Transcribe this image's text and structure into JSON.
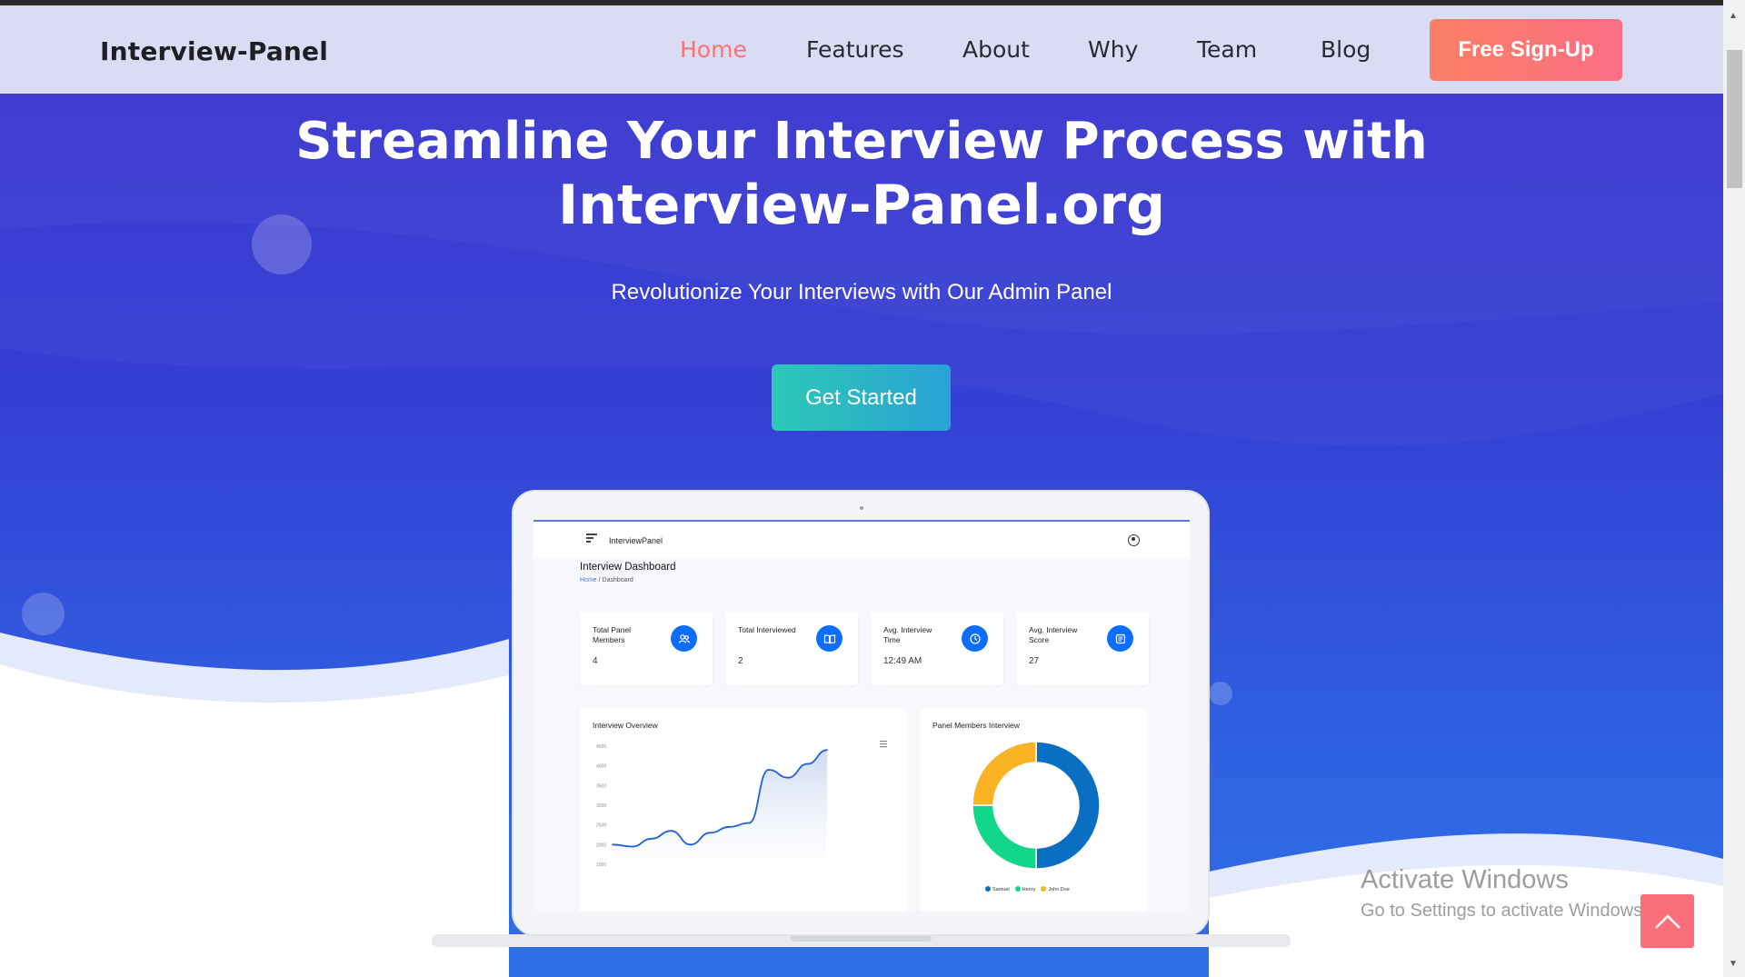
{
  "navbar": {
    "brand": "Interview-Panel",
    "links": [
      "Home",
      "Features",
      "About",
      "Why",
      "Team",
      "Blog"
    ],
    "active": "Home",
    "signup_label": "Free Sign-Up"
  },
  "hero": {
    "title_line1": "Streamline Your Interview Process with",
    "title_line2": "Interview-Panel.org",
    "subtitle": "Revolutionize Your Interviews with Our Admin Panel",
    "cta_label": "Get Started"
  },
  "dashboard": {
    "app_name": "InterviewPanel",
    "title": "Interview Dashboard",
    "breadcrumb": {
      "home": "Home",
      "separator": "/",
      "current": "Dashboard"
    },
    "cards": [
      {
        "label": "Total Panel Members",
        "value": "4",
        "icon": "users-icon"
      },
      {
        "label": "Total Interviewed",
        "value": "2",
        "icon": "book-icon"
      },
      {
        "label": "Avg. Interview Time",
        "value": "12:49 AM",
        "icon": "clock-icon"
      },
      {
        "label": "Avg. Interview Score",
        "value": "27",
        "icon": "report-icon"
      }
    ],
    "overview_title": "Interview Overview",
    "members_title": "Panel Members Interview",
    "line_chart": {
      "type": "line",
      "y_ticks": [
        "4500",
        "4000",
        "3500",
        "3000",
        "2500",
        "2000",
        "1500"
      ],
      "ylim": [
        1500,
        4500
      ],
      "values": [
        2000,
        1950,
        2150,
        2350,
        2000,
        2300,
        2450,
        2550,
        3900,
        3700,
        4050,
        4400
      ],
      "accent": "#1f5fd6"
    },
    "donut_chart": {
      "type": "pie",
      "slices": [
        {
          "label": "Samuel",
          "value": 50,
          "color": "#0a6fc2"
        },
        {
          "label": "Henry",
          "value": 25,
          "color": "#12d68a"
        },
        {
          "label": "John Doe",
          "value": 25,
          "color": "#f8b425"
        }
      ]
    }
  },
  "overlay": {
    "activate_title": "Activate Windows",
    "activate_sub": "Go to Settings to activate Windows."
  }
}
